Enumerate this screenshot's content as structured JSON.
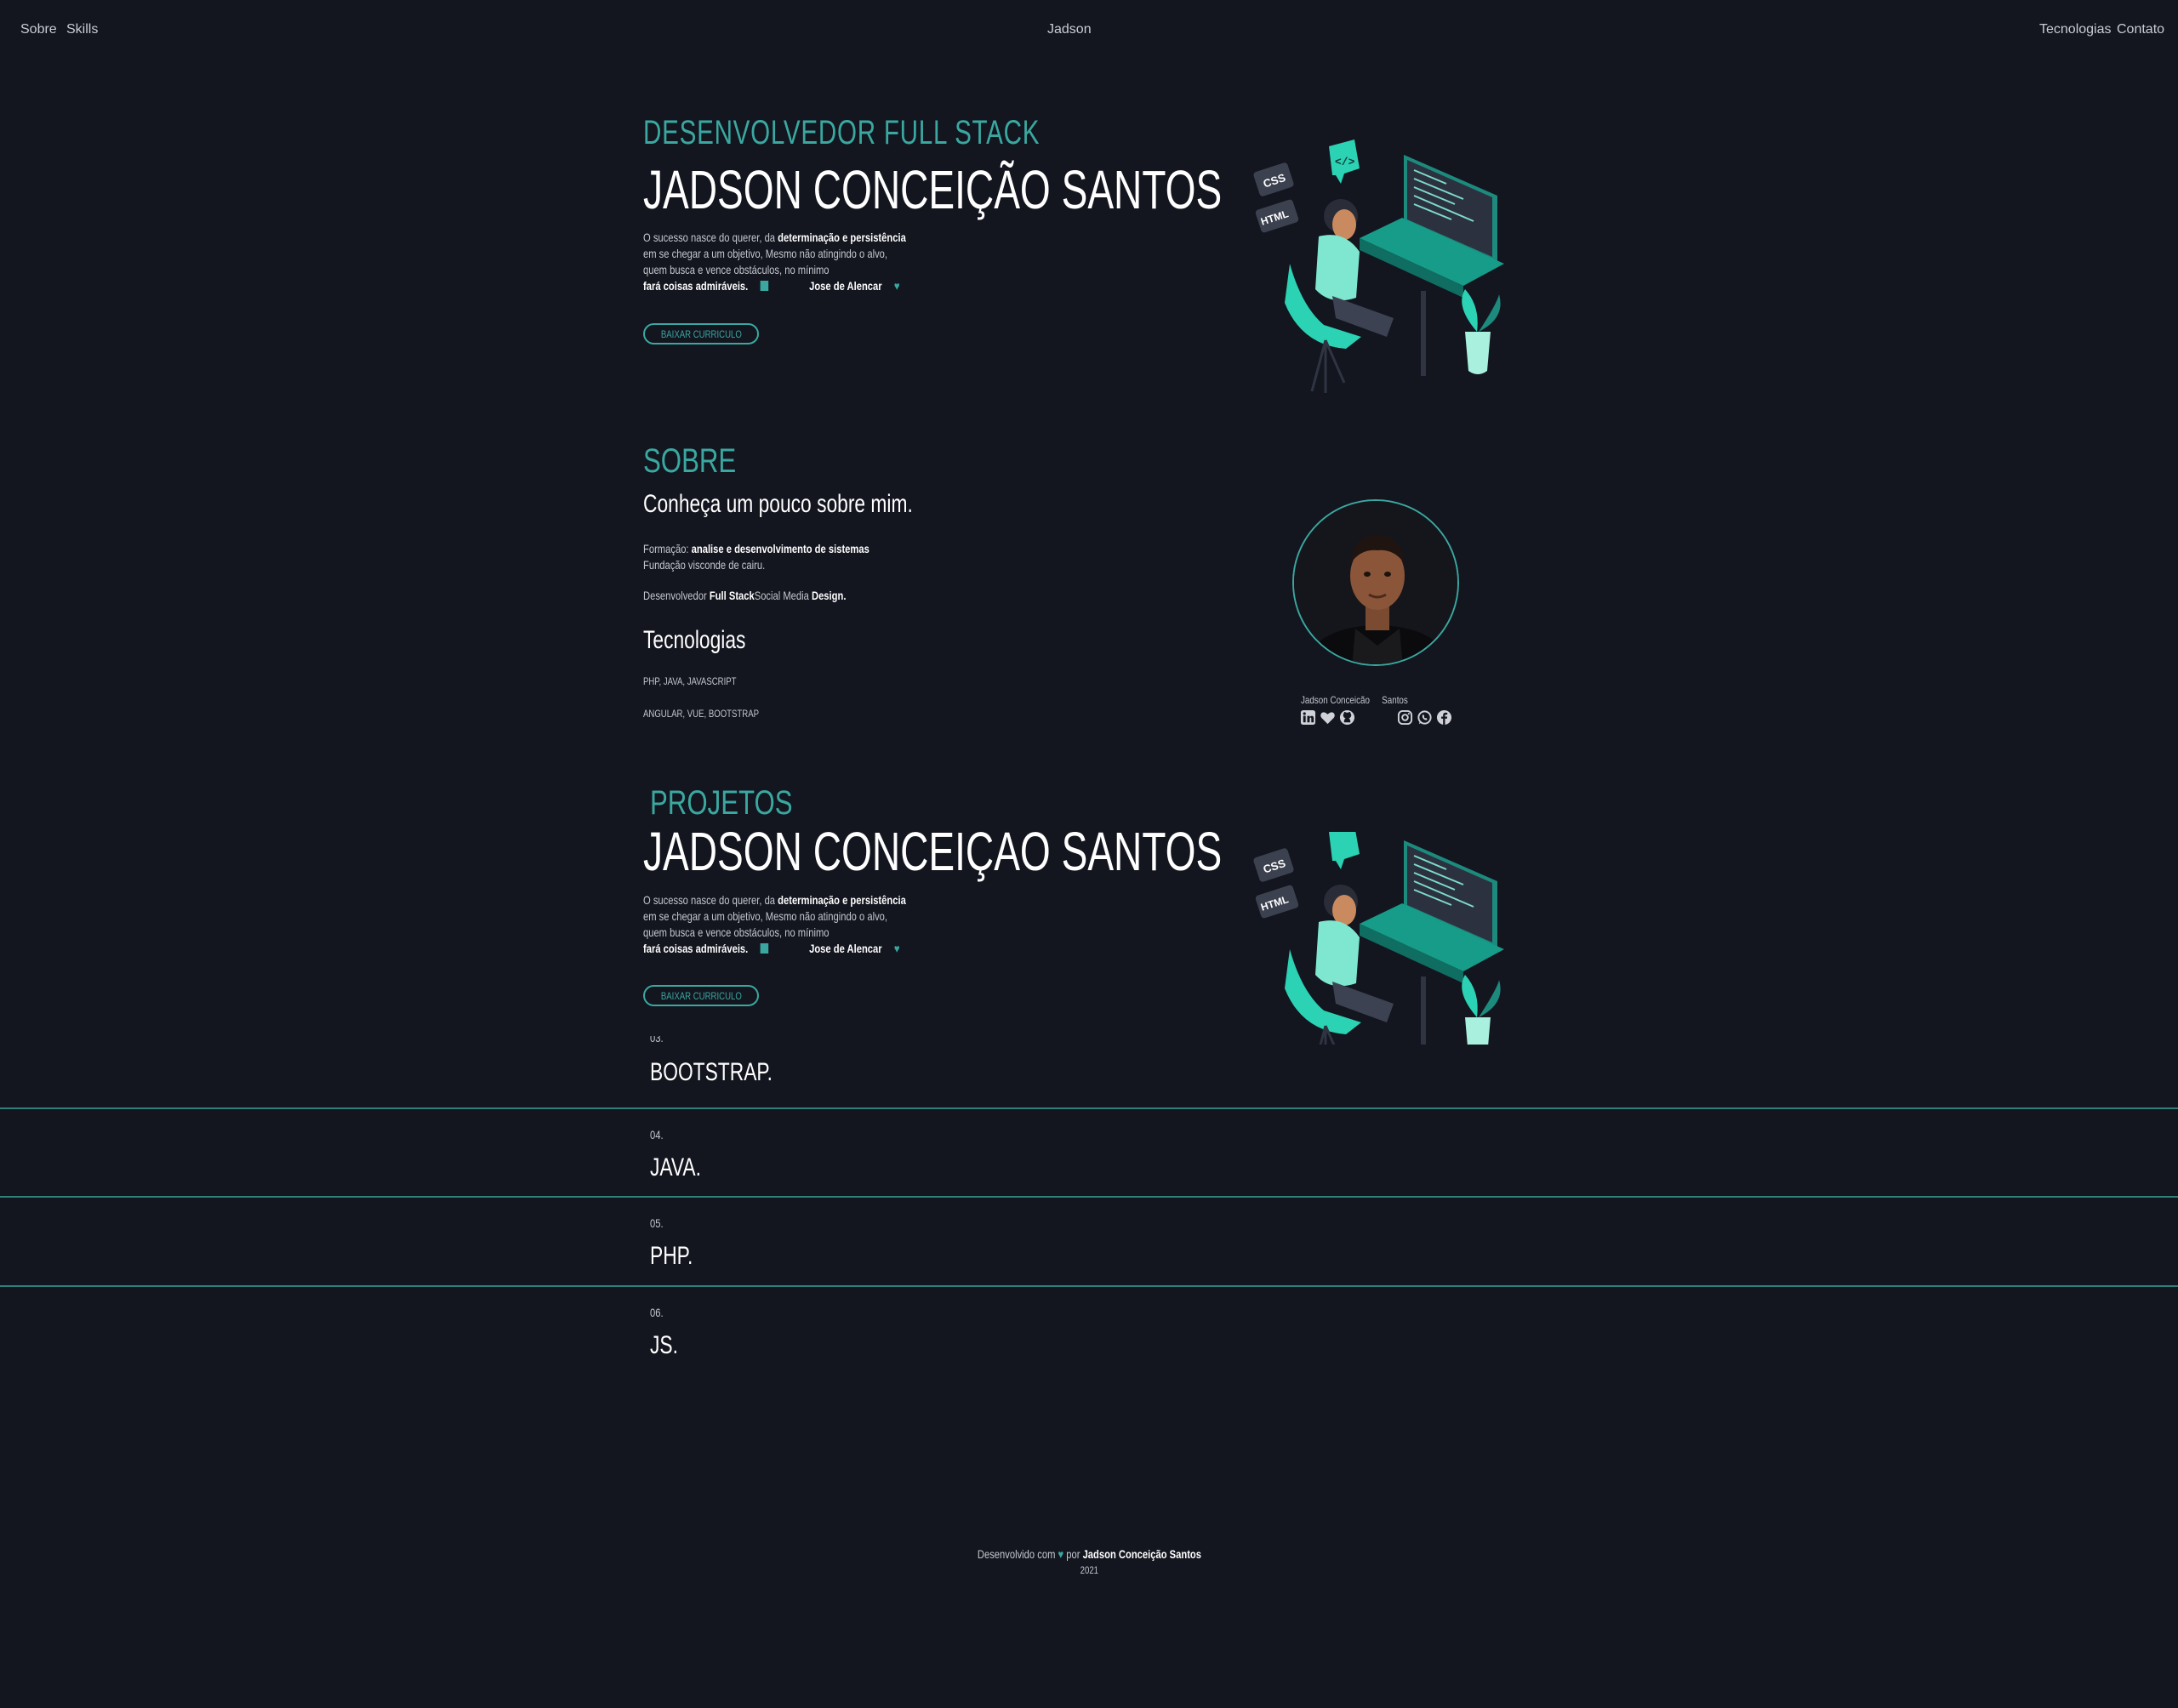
{
  "nav": {
    "left": [
      "Sobre",
      "Skills"
    ],
    "brand": "Jadson",
    "right": [
      "Tecnologias",
      "Contato"
    ]
  },
  "hero": {
    "role": "DESENVOLVEDOR FULL STACK",
    "name": "JADSON CONCEIÇÃO SANTOS",
    "quote_line1_a": "O sucesso nasce do querer, da ",
    "quote_line1_b": "determinação e persistência",
    "quote_line2": "em se chegar a um objetivo, Mesmo não atingindo o alvo,",
    "quote_line3": "quem busca e vence obstáculos, no mínimo",
    "quote_line4": "fará coisas admiráveis.",
    "author": "Jose de Alencar",
    "cv_button": "BAIXAR CURRICULO"
  },
  "about": {
    "title": "SOBRE",
    "subtitle": "Conheça um pouco sobre mim.",
    "formacao_label": "Formação: ",
    "formacao_value": "analise e desenvolvimento de sistemas",
    "instituicao": "Fundação visconde de cairu.",
    "dev_a": "Desenvolvedor ",
    "dev_b": "Full Stack",
    "dev_c": "Social Media ",
    "dev_d": "Design.",
    "tech_title": "Tecnologias",
    "tech_line1": "PHP, JAVA, JAVASCRIPT",
    "tech_line2": "ANGULAR, VUE, BOOTSTRAP",
    "profile_name_a": "Jadson Conceicão",
    "profile_name_b": "Santos",
    "social_icons": [
      "linkedin-icon",
      "heart-icon",
      "github-icon",
      "instagram-icon",
      "whatsapp-icon",
      "facebook-icon"
    ]
  },
  "projects": {
    "title": "PROJETOS",
    "name": "JADSON CONCEIÇAO SANTOS",
    "quote_line1_a": "O sucesso nasce do querer, da ",
    "quote_line1_b": "determinação e persistência",
    "quote_line2": "em se chegar a um objetivo, Mesmo não atingindo o alvo,",
    "quote_line3": "quem busca e vence obstáculos, no mínimo",
    "quote_line4": "fará coisas admiráveis.",
    "author": "Jose de Alencar",
    "cv_button": "BAIXAR CURRICULO"
  },
  "skills": [
    {
      "num": "03.",
      "name": "BOOTSTRAP."
    },
    {
      "num": "04.",
      "name": "JAVA."
    },
    {
      "num": "05.",
      "name": "PHP."
    },
    {
      "num": "06.",
      "name": "JS."
    }
  ],
  "footer": {
    "text_a": "Desenvolvido com ",
    "text_b": " por ",
    "author": "Jadson Conceição Santos",
    "year": "2021"
  },
  "colors": {
    "background": "#13151f",
    "accent": "#3aa8a0",
    "text": "#ffffff"
  }
}
